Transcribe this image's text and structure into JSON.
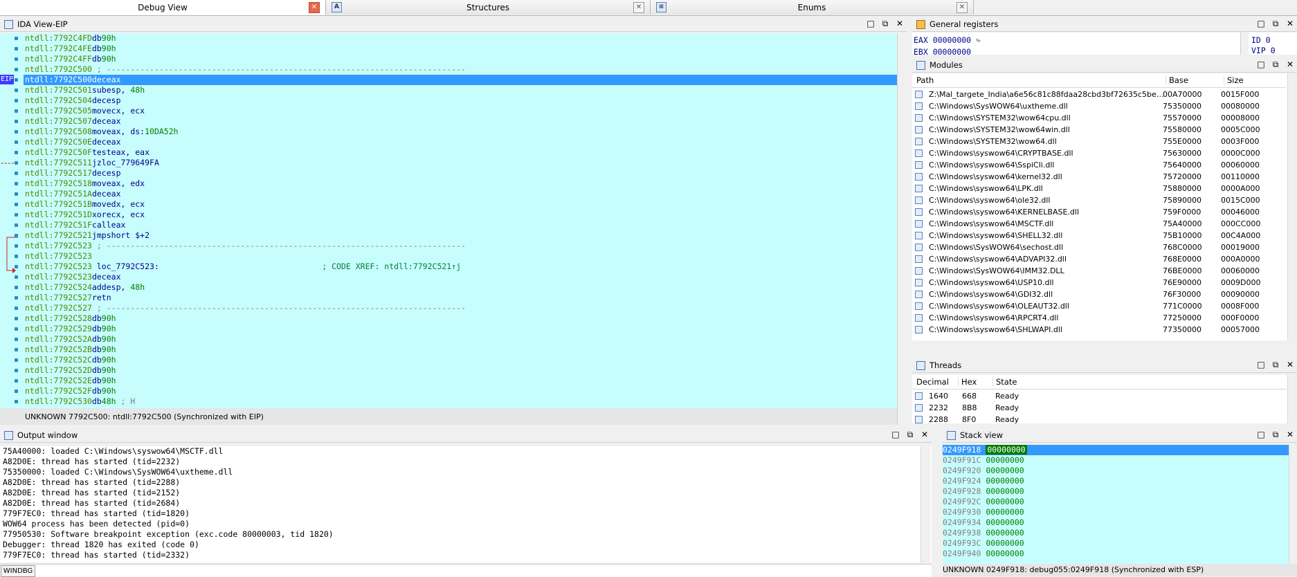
{
  "tabs": [
    {
      "label": "Debug View",
      "active": true,
      "closable": true
    },
    {
      "label": "Structures",
      "active": false,
      "icon": "A"
    },
    {
      "label": "Enums",
      "active": false,
      "icon": "≡"
    }
  ],
  "ida_view": {
    "title": "IDA View-EIP",
    "eip_tag": "EIP",
    "lines": [
      {
        "addr": "ntdll:7792C4FD",
        "mn": "db",
        "op": "",
        "num": "90h"
      },
      {
        "addr": "ntdll:7792C4FE",
        "mn": "db",
        "op": "",
        "num": "90h"
      },
      {
        "addr": "ntdll:7792C4FF",
        "mn": "db",
        "op": "",
        "num": "90h"
      },
      {
        "addr": "ntdll:7792C500",
        "sep": " ; ---------------------------------------------------------------------------"
      },
      {
        "addr": "ntdll:7792C500",
        "mn": "dec",
        "op": "eax",
        "highlight": true
      },
      {
        "addr": "ntdll:7792C501",
        "mn": "sub",
        "op": "esp, ",
        "num": "48h"
      },
      {
        "addr": "ntdll:7792C504",
        "mn": "dec",
        "op": "esp"
      },
      {
        "addr": "ntdll:7792C505",
        "mn": "mov",
        "op": "ecx, ecx"
      },
      {
        "addr": "ntdll:7792C507",
        "mn": "dec",
        "op": "eax"
      },
      {
        "addr": "ntdll:7792C508",
        "mn": "mov",
        "op": "eax, ds:",
        "num": "10DA52h"
      },
      {
        "addr": "ntdll:7792C50E",
        "mn": "dec",
        "op": "eax"
      },
      {
        "addr": "ntdll:7792C50F",
        "mn": "test",
        "op": "eax, eax"
      },
      {
        "addr": "ntdll:7792C511",
        "mn": "jz",
        "op": "loc_779649FA"
      },
      {
        "addr": "ntdll:7792C517",
        "mn": "dec",
        "op": "esp"
      },
      {
        "addr": "ntdll:7792C518",
        "mn": "mov",
        "op": "eax, edx"
      },
      {
        "addr": "ntdll:7792C51A",
        "mn": "dec",
        "op": "eax"
      },
      {
        "addr": "ntdll:7792C51B",
        "mn": "mov",
        "op": "edx, ecx"
      },
      {
        "addr": "ntdll:7792C51D",
        "mn": "xor",
        "op": "ecx, ecx"
      },
      {
        "addr": "ntdll:7792C51F",
        "mn": "call",
        "op": "eax"
      },
      {
        "addr": "ntdll:7792C521",
        "mn": "jmp",
        "op": "short $+2"
      },
      {
        "addr": "ntdll:7792C523",
        "sep": " ; ---------------------------------------------------------------------------"
      },
      {
        "addr": "ntdll:7792C523",
        "mn": "",
        "op": ""
      },
      {
        "addr": "ntdll:7792C523",
        "label": " loc_7792C523:",
        "cmt": "; CODE XREF: ntdll:7792C521↑j"
      },
      {
        "addr": "ntdll:7792C523",
        "mn": "dec",
        "op": "eax"
      },
      {
        "addr": "ntdll:7792C524",
        "mn": "add",
        "op": "esp, ",
        "num": "48h"
      },
      {
        "addr": "ntdll:7792C527",
        "mn": "retn",
        "op": ""
      },
      {
        "addr": "ntdll:7792C527",
        "sep": " ; ---------------------------------------------------------------------------"
      },
      {
        "addr": "ntdll:7792C528",
        "mn": "db",
        "op": "",
        "num": "90h"
      },
      {
        "addr": "ntdll:7792C529",
        "mn": "db",
        "op": "",
        "num": "90h"
      },
      {
        "addr": "ntdll:7792C52A",
        "mn": "db",
        "op": "",
        "num": "90h"
      },
      {
        "addr": "ntdll:7792C52B",
        "mn": "db",
        "op": "",
        "num": "90h"
      },
      {
        "addr": "ntdll:7792C52C",
        "mn": "db",
        "op": "",
        "num": "90h"
      },
      {
        "addr": "ntdll:7792C52D",
        "mn": "db",
        "op": "",
        "num": "90h"
      },
      {
        "addr": "ntdll:7792C52E",
        "mn": "db",
        "op": "",
        "num": "90h"
      },
      {
        "addr": "ntdll:7792C52F",
        "mn": "db",
        "op": "",
        "num": "90h"
      },
      {
        "addr": "ntdll:7792C530",
        "mn": "db",
        "op": "",
        "num": "48h",
        "cmt": " ; H"
      }
    ],
    "status": "UNKNOWN  7792C500: ntdll:7792C500  (Synchronized with EIP)"
  },
  "general_registers": {
    "title": "General registers",
    "eax_name": "EAX",
    "eax_value": "00000000",
    "ebx_partial": "EBX 00000000",
    "flag1": "ID   0",
    "flag2": "VIP  0"
  },
  "modules": {
    "title": "Modules",
    "headers": {
      "path": "Path",
      "base": "Base",
      "size": "Size"
    },
    "rows": [
      {
        "path": "Z:\\Mal_targete_India\\a6e56c81c88fdaa28cbd3bf72635c5becb164f...",
        "base": "00A70000",
        "size": "0015F000"
      },
      {
        "path": "C:\\Windows\\SysWOW64\\uxtheme.dll",
        "base": "75350000",
        "size": "00080000"
      },
      {
        "path": "C:\\Windows\\SYSTEM32\\wow64cpu.dll",
        "base": "75570000",
        "size": "00008000"
      },
      {
        "path": "C:\\Windows\\SYSTEM32\\wow64win.dll",
        "base": "75580000",
        "size": "0005C000"
      },
      {
        "path": "C:\\Windows\\SYSTEM32\\wow64.dll",
        "base": "755E0000",
        "size": "0003F000"
      },
      {
        "path": "C:\\Windows\\syswow64\\CRYPTBASE.dll",
        "base": "75630000",
        "size": "0000C000"
      },
      {
        "path": "C:\\Windows\\syswow64\\SspiCli.dll",
        "base": "75640000",
        "size": "00060000"
      },
      {
        "path": "C:\\Windows\\syswow64\\kernel32.dll",
        "base": "75720000",
        "size": "00110000"
      },
      {
        "path": "C:\\Windows\\syswow64\\LPK.dll",
        "base": "75880000",
        "size": "0000A000"
      },
      {
        "path": "C:\\Windows\\syswow64\\ole32.dll",
        "base": "75890000",
        "size": "0015C000"
      },
      {
        "path": "C:\\Windows\\syswow64\\KERNELBASE.dll",
        "base": "759F0000",
        "size": "00046000"
      },
      {
        "path": "C:\\Windows\\syswow64\\MSCTF.dll",
        "base": "75A40000",
        "size": "000CC000"
      },
      {
        "path": "C:\\Windows\\syswow64\\SHELL32.dll",
        "base": "75B10000",
        "size": "00C4A000"
      },
      {
        "path": "C:\\Windows\\SysWOW64\\sechost.dll",
        "base": "768C0000",
        "size": "00019000"
      },
      {
        "path": "C:\\Windows\\syswow64\\ADVAPI32.dll",
        "base": "768E0000",
        "size": "000A0000"
      },
      {
        "path": "C:\\Windows\\SysWOW64\\IMM32.DLL",
        "base": "76BE0000",
        "size": "00060000"
      },
      {
        "path": "C:\\Windows\\syswow64\\USP10.dll",
        "base": "76E90000",
        "size": "0009D000"
      },
      {
        "path": "C:\\Windows\\syswow64\\GDI32.dll",
        "base": "76F30000",
        "size": "00090000"
      },
      {
        "path": "C:\\Windows\\syswow64\\OLEAUT32.dll",
        "base": "771C0000",
        "size": "0008F000"
      },
      {
        "path": "C:\\Windows\\syswow64\\RPCRT4.dll",
        "base": "77250000",
        "size": "000F0000"
      },
      {
        "path": "C:\\Windows\\syswow64\\SHLWAPI.dll",
        "base": "77350000",
        "size": "00057000"
      }
    ]
  },
  "threads": {
    "title": "Threads",
    "headers": {
      "decimal": "Decimal",
      "hex": "Hex",
      "state": "State"
    },
    "rows": [
      {
        "decimal": "1640",
        "hex": "668",
        "state": "Ready"
      },
      {
        "decimal": "2232",
        "hex": "8B8",
        "state": "Ready"
      },
      {
        "decimal": "2288",
        "hex": "8F0",
        "state": "Ready"
      }
    ]
  },
  "output": {
    "title": "Output window",
    "lines": [
      "75A40000: loaded C:\\Windows\\syswow64\\MSCTF.dll",
      "A82D0E: thread has started (tid=2232)",
      "75350000: loaded C:\\Windows\\SysWOW64\\uxtheme.dll",
      "A82D0E: thread has started (tid=2288)",
      "A82D0E: thread has started (tid=2152)",
      "A82D0E: thread has started (tid=2684)",
      "779F7EC0: thread has started (tid=1820)",
      "WOW64 process has been detected (pid=0)",
      "77950530: Software breakpoint exception (exc.code 80000003, tid 1820)",
      "Debugger: thread 1820 has exited (code 0)",
      "779F7EC0: thread has started (tid=2332)"
    ],
    "command_label": "WINDBG"
  },
  "stack_view": {
    "title": "Stack view",
    "rows": [
      {
        "addr": "0249F918",
        "val": "00000000",
        "highlight": true
      },
      {
        "addr": "0249F91C",
        "val": "00000000"
      },
      {
        "addr": "0249F920",
        "val": "00000000"
      },
      {
        "addr": "0249F924",
        "val": "00000000"
      },
      {
        "addr": "0249F928",
        "val": "00000000"
      },
      {
        "addr": "0249F92C",
        "val": "00000000"
      },
      {
        "addr": "0249F930",
        "val": "00000000"
      },
      {
        "addr": "0249F934",
        "val": "00000000"
      },
      {
        "addr": "0249F938",
        "val": "00000000"
      },
      {
        "addr": "0249F93C",
        "val": "00000000"
      },
      {
        "addr": "0249F940",
        "val": "00000000"
      }
    ],
    "status": "UNKNOWN  0249F918: debug055:0249F918  (Synchronized with ESP)"
  },
  "colors": {
    "code_bg": "#c8fdfd",
    "highlight": "#3399ff",
    "address": "#4d8a00",
    "mnemonic": "#00008b",
    "number": "#008000"
  }
}
